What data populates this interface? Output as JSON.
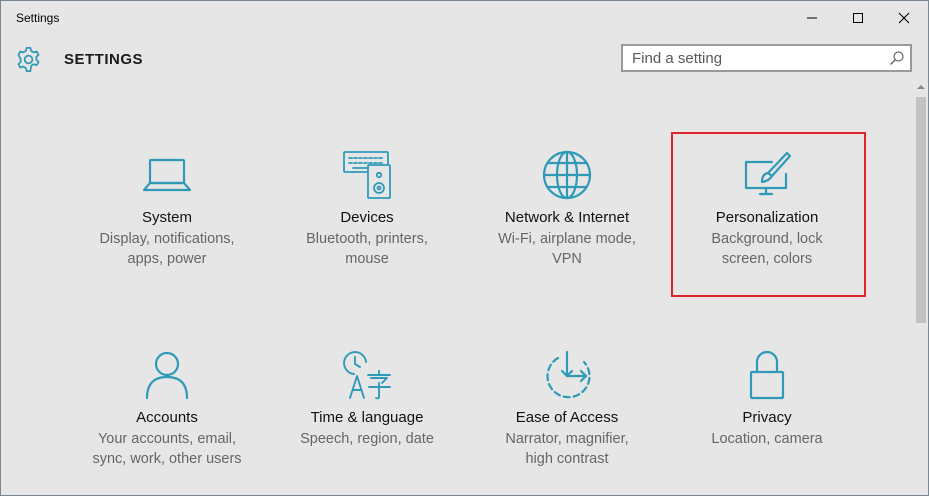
{
  "window": {
    "title": "Settings",
    "controls": [
      "minimize",
      "maximize",
      "close"
    ]
  },
  "header": {
    "icon": "gear-icon",
    "title": "SETTINGS"
  },
  "search": {
    "placeholder": "Find a setting",
    "value": "",
    "icon": "search-icon"
  },
  "colors": {
    "accent": "#2f9ab8",
    "highlight": "#e0242b",
    "background": "#e6e6e6"
  },
  "tiles": [
    {
      "name": "System",
      "desc_line1": "Display, notifications,",
      "desc_line2": "apps, power",
      "icon": "laptop-icon"
    },
    {
      "name": "Devices",
      "desc_line1": "Bluetooth, printers,",
      "desc_line2": "mouse",
      "icon": "keyboard-speaker-icon"
    },
    {
      "name": "Network & Internet",
      "desc_line1": "Wi-Fi, airplane mode,",
      "desc_line2": "VPN",
      "icon": "globe-icon"
    },
    {
      "name": "Personalization",
      "desc_line1": "Background, lock",
      "desc_line2": "screen, colors",
      "icon": "paintbrush-screen-icon",
      "highlighted": true
    },
    {
      "name": "Accounts",
      "desc_line1": "Your accounts, email,",
      "desc_line2": "sync, work, other users",
      "icon": "person-icon"
    },
    {
      "name": "Time & language",
      "desc_line1": "Speech, region, date",
      "desc_line2": "",
      "icon": "clock-language-icon"
    },
    {
      "name": "Ease of Access",
      "desc_line1": "Narrator, magnifier,",
      "desc_line2": "high contrast",
      "icon": "ease-of-access-icon"
    },
    {
      "name": "Privacy",
      "desc_line1": "Location, camera",
      "desc_line2": "",
      "icon": "lock-icon"
    }
  ]
}
